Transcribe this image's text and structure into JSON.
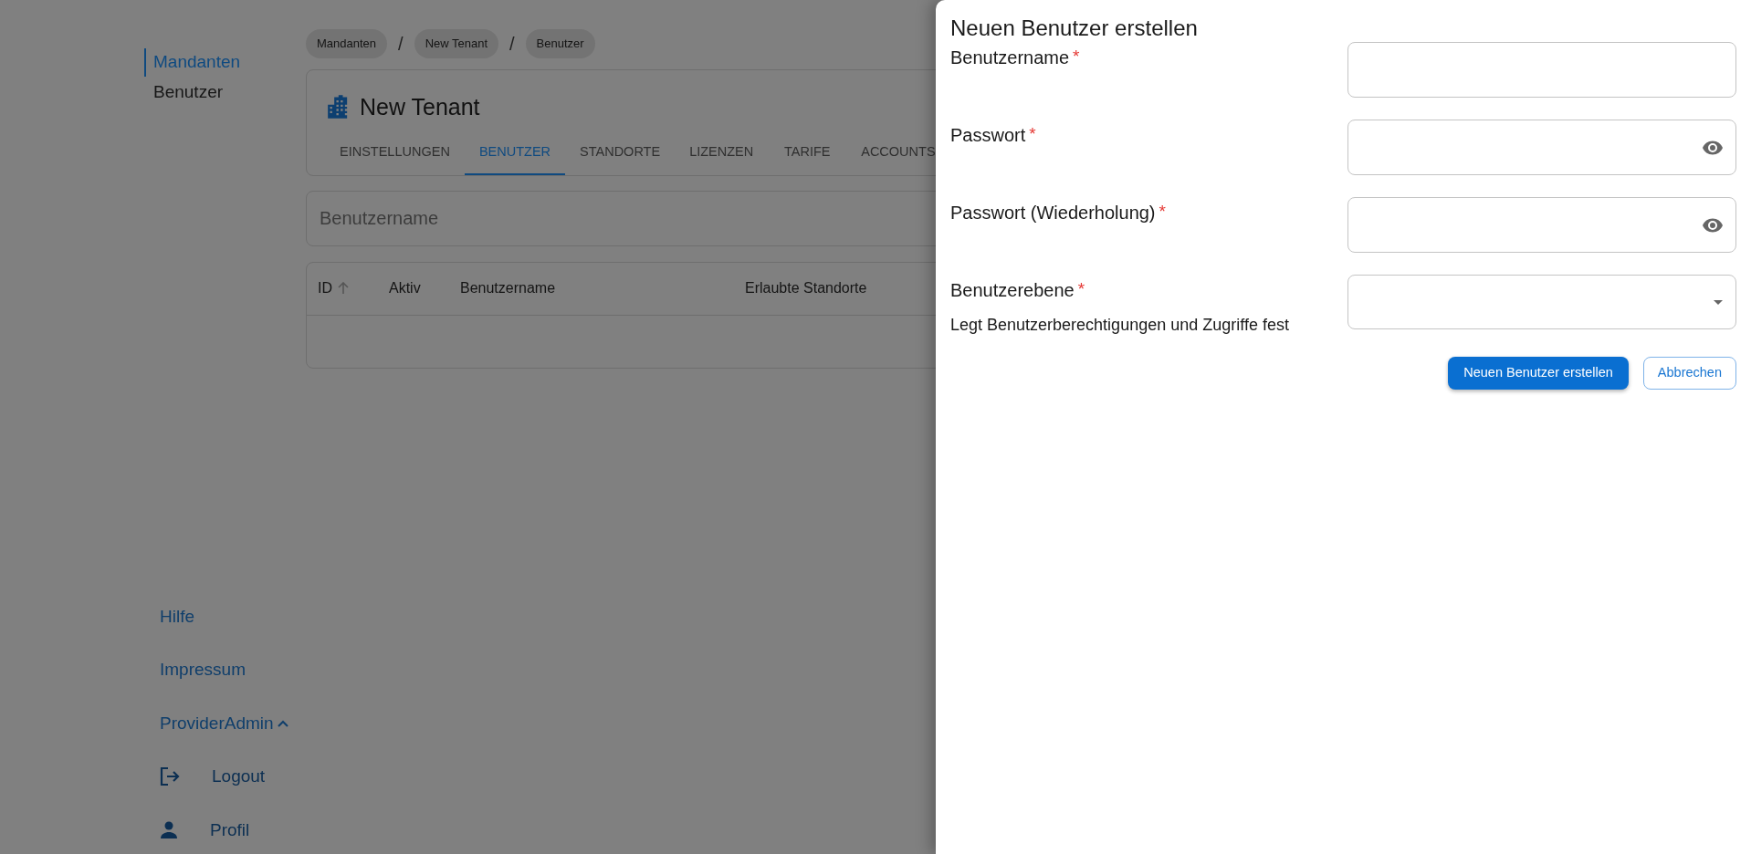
{
  "sidebar": {
    "items": [
      {
        "label": "Mandanten",
        "selected": true
      },
      {
        "label": "Benutzer",
        "selected": false
      }
    ],
    "footer": [
      {
        "label": "Hilfe",
        "kind": "link"
      },
      {
        "label": "Impressum",
        "kind": "link"
      },
      {
        "label": "ProviderAdmin",
        "kind": "menu",
        "expanded": true
      },
      {
        "label": "Logout",
        "kind": "logout"
      },
      {
        "label": "Profil",
        "kind": "profile"
      }
    ]
  },
  "breadcrumbs": {
    "items": [
      "Mandanten",
      "New Tenant",
      "Benutzer"
    ],
    "separators": [
      "/",
      "/"
    ]
  },
  "tenant": {
    "title": "New Tenant",
    "tabs": [
      {
        "label": "EINSTELLUNGEN",
        "selected": false
      },
      {
        "label": "BENUTZER",
        "selected": true
      },
      {
        "label": "STANDORTE",
        "selected": false
      },
      {
        "label": "LIZENZEN",
        "selected": false
      },
      {
        "label": "TARIFE",
        "selected": false
      },
      {
        "label": "ACCOUNTS",
        "selected": false
      }
    ]
  },
  "search": {
    "placeholder": "Benutzername"
  },
  "table": {
    "columns": [
      {
        "label": "ID",
        "sorted": true
      },
      {
        "label": "Aktiv",
        "sorted": false
      },
      {
        "label": "Benutzername",
        "sorted": false
      },
      {
        "label": "Erlaubte Standorte",
        "sorted": false
      }
    ]
  },
  "drawer": {
    "title": "Neuen Benutzer erstellen",
    "fields": [
      {
        "label": "Benutzername",
        "required_mark": "*",
        "kind": "text"
      },
      {
        "label": "Passwort",
        "required_mark": "*",
        "kind": "password"
      },
      {
        "label": "Passwort (Wiederholung)",
        "required_mark": "*",
        "kind": "password"
      },
      {
        "label": "Benutzerebene",
        "required_mark": "*",
        "kind": "select",
        "hint": "Legt Benutzerberechtigungen und Zugriffe fest"
      }
    ],
    "buttons": [
      {
        "label": "Neuen Benutzer erstellen",
        "kind": "primary"
      },
      {
        "label": "Abbrechen",
        "kind": "secondary"
      }
    ]
  }
}
